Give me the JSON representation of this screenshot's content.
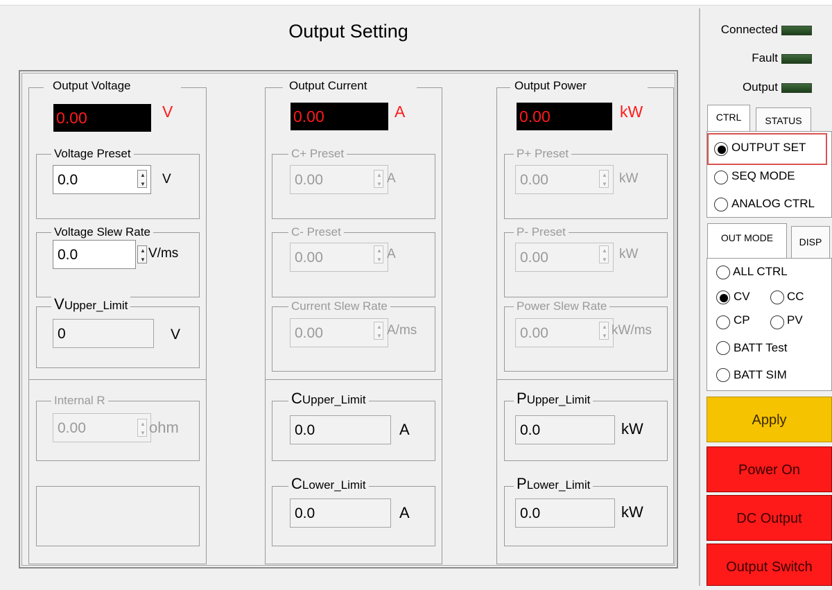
{
  "title": "Output Setting",
  "voltage": {
    "group_title": "Output Voltage",
    "readout": "0.00",
    "readout_unit": "V",
    "preset": {
      "title": "Voltage Preset",
      "value": "0.0",
      "unit": "V"
    },
    "slew": {
      "title": "Voltage Slew Rate",
      "value": "0.0",
      "unit": "V/ms"
    },
    "upper": {
      "letter": "V",
      "sub": "Upper_Limit",
      "value": "0",
      "unit": "V"
    },
    "internal_r": {
      "title": "Internal R",
      "value": "0.00",
      "unit": "ohm"
    }
  },
  "current": {
    "group_title": "Output Current",
    "readout": "0.00",
    "readout_unit": "A",
    "cplus": {
      "title": "C+ Preset",
      "value": "0.00",
      "unit": "A"
    },
    "cminus": {
      "title": "C- Preset",
      "value": "0.00",
      "unit": "A"
    },
    "slew": {
      "title": "Current Slew Rate",
      "value": "0.00",
      "unit": "A/ms"
    },
    "upper": {
      "letter": "C",
      "sub": "Upper_Limit",
      "value": "0.0",
      "unit": "A"
    },
    "lower": {
      "letter": "C",
      "sub": "Lower_Limit",
      "value": "0.0",
      "unit": "A"
    }
  },
  "power": {
    "group_title": "Output Power",
    "readout": "0.00",
    "readout_unit": "kW",
    "pplus": {
      "title": "P+ Preset",
      "value": "0.00",
      "unit": "kW"
    },
    "pminus": {
      "title": "P- Preset",
      "value": "0.00",
      "unit": "kW"
    },
    "slew": {
      "title": "Power Slew Rate",
      "value": "0.00",
      "unit": "kW/ms"
    },
    "upper": {
      "letter": "P",
      "sub": "Upper_Limit",
      "value": "0.0",
      "unit": "kW"
    },
    "lower": {
      "letter": "P",
      "sub": "Lower_Limit",
      "value": "0.0",
      "unit": "kW"
    }
  },
  "status": {
    "connected": "Connected",
    "fault": "Fault",
    "output": "Output",
    "led_color": "#2e5a2c"
  },
  "tabs1": [
    "CTRL",
    "STATUS"
  ],
  "ctrl_options": [
    {
      "label": "OUTPUT SET",
      "selected": true
    },
    {
      "label": "SEQ MODE",
      "selected": false
    },
    {
      "label": "ANALOG CTRL",
      "selected": false
    }
  ],
  "tabs2": [
    "OUT MODE",
    "DISP"
  ],
  "mode_options": {
    "all_ctrl": "ALL CTRL",
    "cv": "CV",
    "cc": "CC",
    "cp": "CP",
    "pv": "PV",
    "batt_test": "BATT Test",
    "batt_sim": "BATT SIM",
    "selected": "CV"
  },
  "buttons": {
    "apply": "Apply",
    "power_on": "Power On",
    "dc_output": "DC Output",
    "output_switch": "Output Switch"
  },
  "colors": {
    "red": "#ff1a1a",
    "yellow": "#f6c300",
    "highlight": "#d9534f"
  }
}
